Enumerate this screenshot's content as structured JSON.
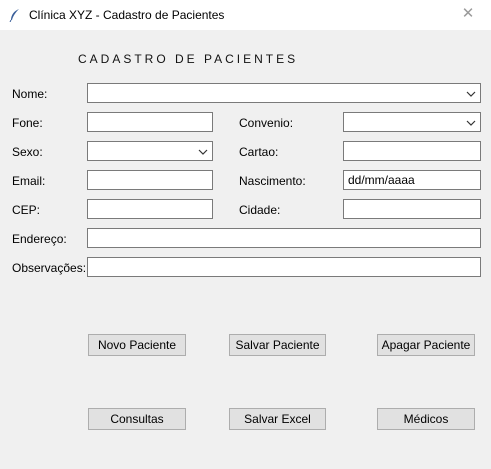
{
  "window": {
    "title": "Clínica XYZ - Cadastro de Pacientes",
    "app_icon": "feather-icon",
    "close_icon": "close-icon"
  },
  "form": {
    "section_title": "CADASTRO DE PACIENTES",
    "labels": {
      "nome": "Nome:",
      "fone": "Fone:",
      "convenio": "Convenio:",
      "sexo": "Sexo:",
      "cartao": "Cartao:",
      "email": "Email:",
      "nascimento": "Nascimento:",
      "cep": "CEP:",
      "cidade": "Cidade:",
      "endereco": "Endereço:",
      "observacoes": "Observações:"
    },
    "values": {
      "nome": "",
      "fone": "",
      "convenio": "",
      "sexo": "",
      "cartao": "",
      "email": "",
      "nascimento": "dd/mm/aaaa",
      "cep": "",
      "cidade": "",
      "endereco": "",
      "observacoes": ""
    }
  },
  "buttons": {
    "novo_paciente": "Novo Paciente",
    "salvar_paciente": "Salvar Paciente",
    "apagar_paciente": "Apagar Paciente",
    "consultas": "Consultas",
    "salvar_excel": "Salvar Excel",
    "medicos": "Médicos"
  },
  "colors": {
    "window_bg": "#f0f0f0",
    "titlebar_bg": "#ffffff",
    "field_border": "#7a7a7a",
    "button_bg": "#e1e1e1"
  }
}
